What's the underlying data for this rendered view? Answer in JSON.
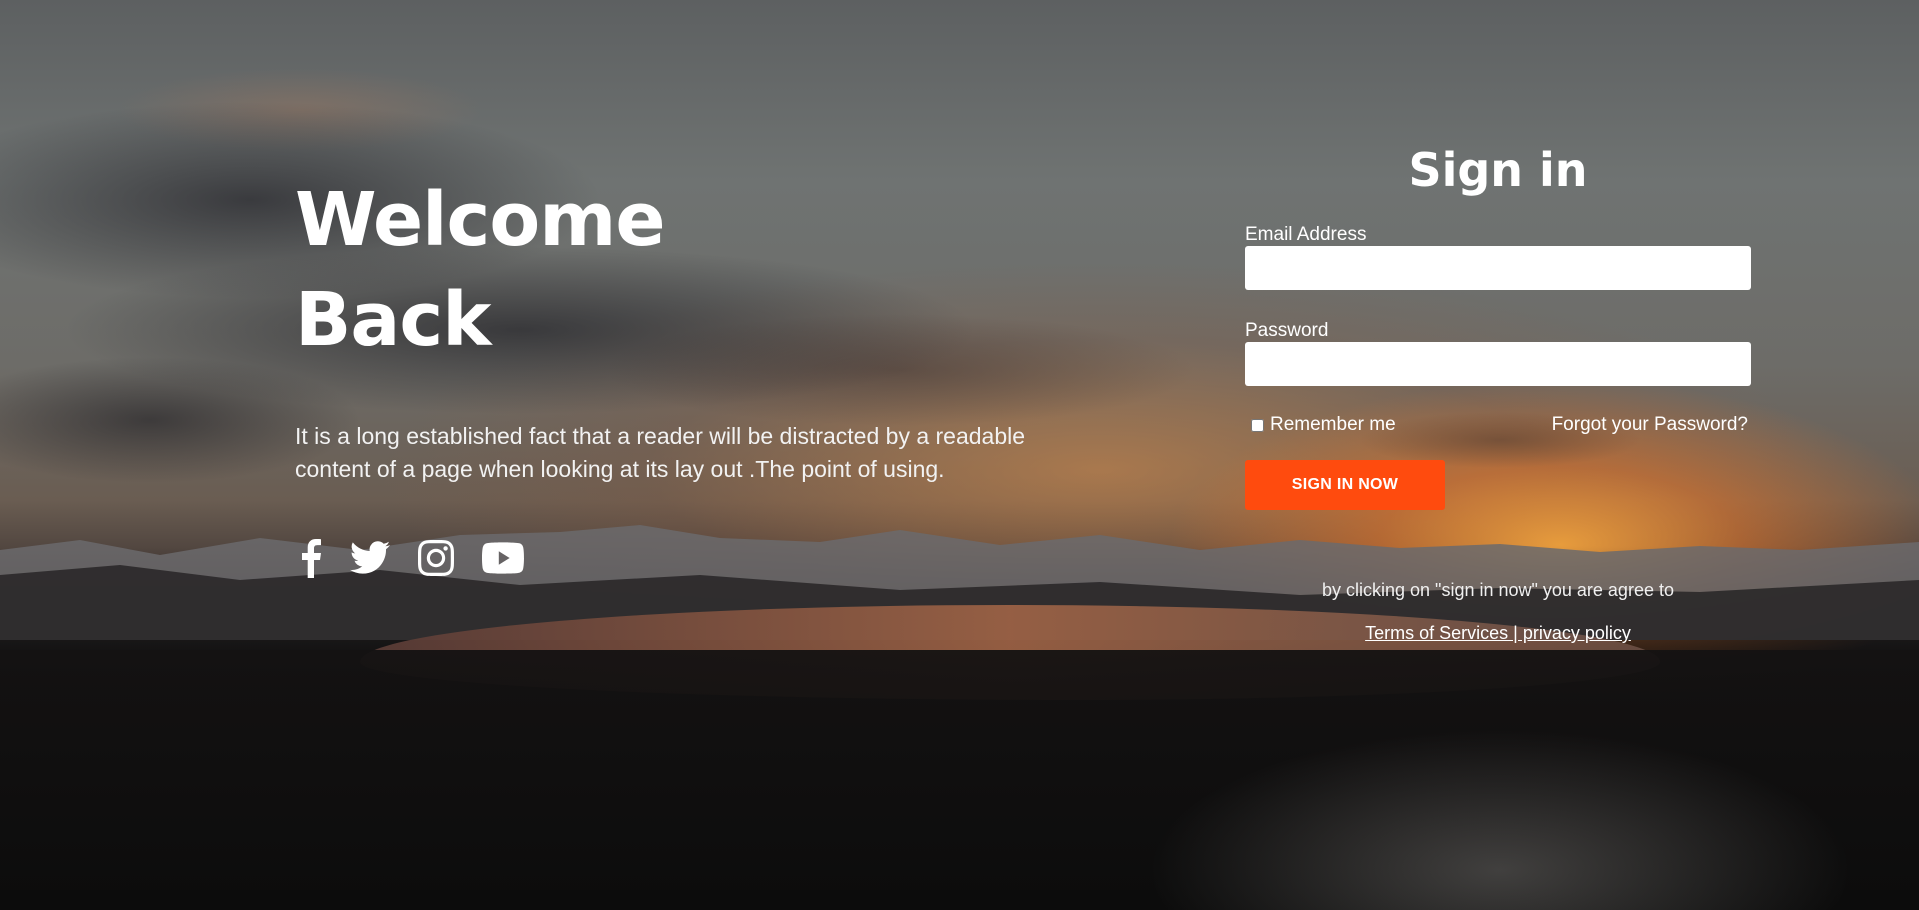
{
  "hero": {
    "title_line1": "Welcome",
    "title_line2": "Back",
    "description": "It is a long established fact that a reader will be distracted by a readable content of a page when looking at its lay out .The point of using."
  },
  "social": {
    "icons": [
      "facebook-icon",
      "twitter-icon",
      "instagram-icon",
      "youtube-icon"
    ]
  },
  "signin": {
    "title": "Sign in",
    "email_label": "Email Address",
    "email_value": "",
    "password_label": "Password",
    "password_value": "",
    "remember_label": "Remember me",
    "remember_checked": false,
    "forgot_label": "Forgot your Password?",
    "button_label": "SIGN IN NOW",
    "agree_text": "by clicking on \"sign in now\" you are agree to",
    "legal_link": "Terms of Services | privacy policy"
  },
  "colors": {
    "accent": "#ff4b0e",
    "text": "#ffffff",
    "input_bg": "#ffffff"
  }
}
